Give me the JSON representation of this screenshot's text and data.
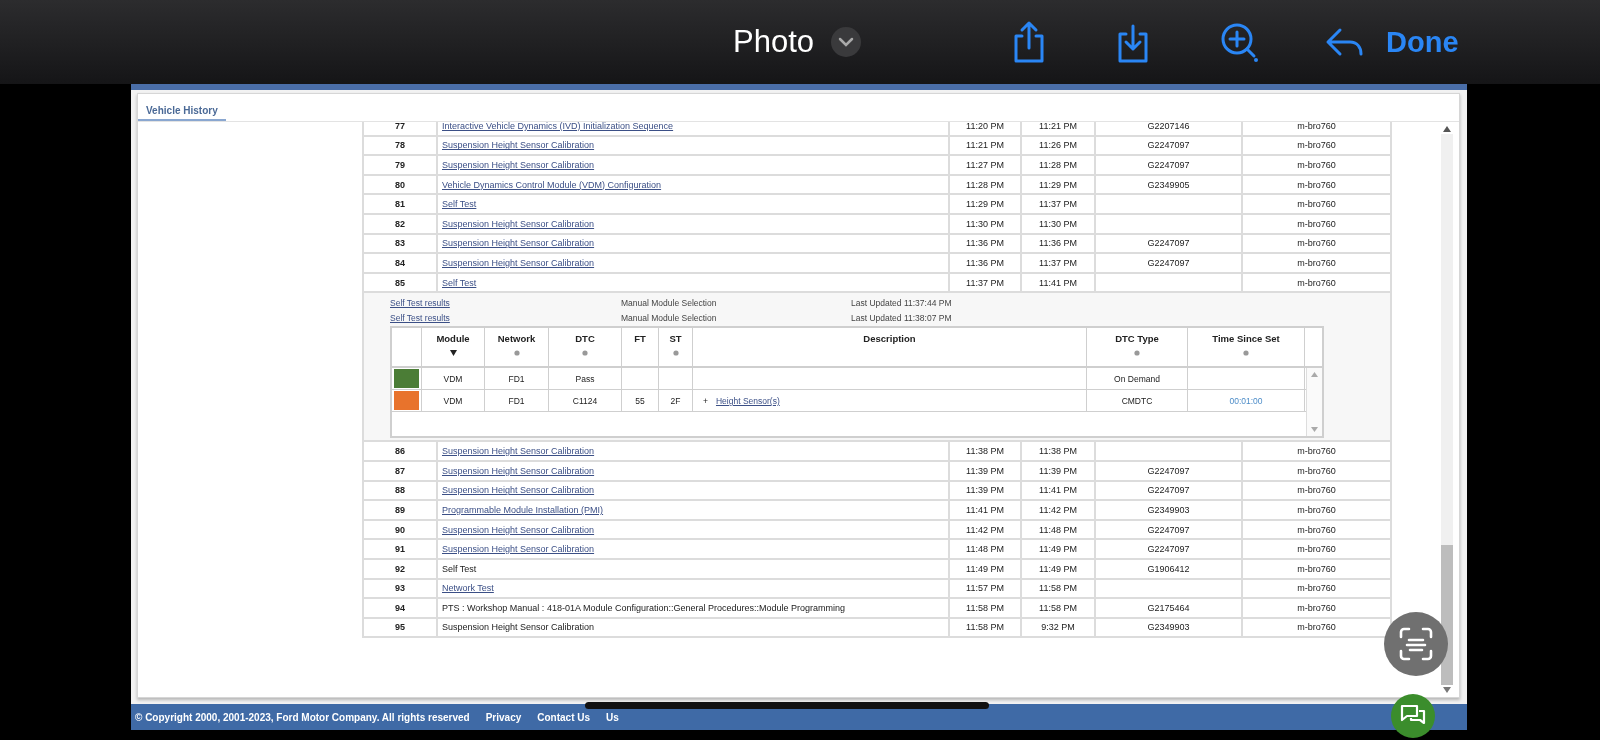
{
  "viewer": {
    "title": "Photo",
    "done": "Done"
  },
  "tab": {
    "label": "Vehicle History",
    "selected": true
  },
  "history": {
    "rows": [
      {
        "number": "77",
        "description": "Interactive Vehicle Dynamics (IVD) Initialization Sequence",
        "link": true,
        "start": "11:20 PM",
        "end": "11:21 PM",
        "code": "G2207146",
        "user": "m-bro760"
      },
      {
        "number": "78",
        "description": "Suspension Height Sensor Calibration",
        "link": true,
        "start": "11:21 PM",
        "end": "11:26 PM",
        "code": "G2247097",
        "user": "m-bro760"
      },
      {
        "number": "79",
        "description": "Suspension Height Sensor Calibration",
        "link": true,
        "start": "11:27 PM",
        "end": "11:28 PM",
        "code": "G2247097",
        "user": "m-bro760"
      },
      {
        "number": "80",
        "description": "Vehicle Dynamics Control Module (VDM) Configuration",
        "link": true,
        "start": "11:28 PM",
        "end": "11:29 PM",
        "code": "G2349905",
        "user": "m-bro760"
      },
      {
        "number": "81",
        "description": "Self Test",
        "link": true,
        "start": "11:29 PM",
        "end": "11:37 PM",
        "user": "m-bro760"
      },
      {
        "number": "82",
        "description": "Suspension Height Sensor Calibration",
        "link": true,
        "start": "11:30 PM",
        "end": "11:30 PM",
        "user": "m-bro760"
      },
      {
        "number": "83",
        "description": "Suspension Height Sensor Calibration",
        "link": true,
        "start": "11:36 PM",
        "end": "11:36 PM",
        "code": "G2247097",
        "user": "m-bro760"
      },
      {
        "number": "84",
        "description": "Suspension Height Sensor Calibration",
        "link": true,
        "start": "11:36 PM",
        "end": "11:37 PM",
        "code": "G2247097",
        "user": "m-bro760"
      },
      {
        "number": "85",
        "description": "Self Test",
        "link": true,
        "start": "11:37 PM",
        "end": "11:41 PM",
        "user": "m-bro760",
        "details": {
          "results": [
            {
              "label": "Self Test results",
              "selection": "Manual Module Selection",
              "updated": "Last Updated 11:37:44 PM"
            },
            {
              "label": "Self Test results",
              "selection": "Manual Module Selection",
              "updated": "Last Updated 11:38:07 PM"
            }
          ],
          "columns": [
            {
              "label": "Module",
              "sorted": true
            },
            {
              "label": "Network",
              "sorted": false
            },
            {
              "label": "DTC",
              "sorted": false
            },
            {
              "label": "FT"
            },
            {
              "label": "ST",
              "sorted": false
            },
            {
              "label": "Description"
            },
            {
              "label": "DTC Type",
              "sorted": false
            },
            {
              "label": "Time Since Set",
              "sorted": false
            }
          ],
          "dtc_rows": [
            {
              "color": "#4b7d36",
              "module": "VDM",
              "network": "FD1",
              "dtc": "Pass",
              "type": "On Demand"
            },
            {
              "color": "#e8732c",
              "module": "VDM",
              "network": "FD1",
              "dtc": "C1124",
              "ft": "55",
              "st": "2F",
              "expander": "+",
              "description": "Height Sensor(s)",
              "type": "CMDTC",
              "time": "00:01:00"
            }
          ]
        }
      },
      {
        "number": "86",
        "description": "Suspension Height Sensor Calibration",
        "link": true,
        "start": "11:38 PM",
        "end": "11:38 PM",
        "user": "m-bro760"
      },
      {
        "number": "87",
        "description": "Suspension Height Sensor Calibration",
        "link": true,
        "start": "11:39 PM",
        "end": "11:39 PM",
        "code": "G2247097",
        "user": "m-bro760"
      },
      {
        "number": "88",
        "description": "Suspension Height Sensor Calibration",
        "link": true,
        "start": "11:39 PM",
        "end": "11:41 PM",
        "code": "G2247097",
        "user": "m-bro760"
      },
      {
        "number": "89",
        "description": "Programmable Module Installation (PMI)",
        "link": true,
        "start": "11:41 PM",
        "end": "11:42 PM",
        "code": "G2349903",
        "user": "m-bro760"
      },
      {
        "number": "90",
        "description": "Suspension Height Sensor Calibration",
        "link": true,
        "start": "11:42 PM",
        "end": "11:48 PM",
        "code": "G2247097",
        "user": "m-bro760"
      },
      {
        "number": "91",
        "description": "Suspension Height Sensor Calibration",
        "link": true,
        "start": "11:48 PM",
        "end": "11:49 PM",
        "code": "G2247097",
        "user": "m-bro760"
      },
      {
        "number": "92",
        "description": "Self Test",
        "link": false,
        "start": "11:49 PM",
        "end": "11:49 PM",
        "code": "G1906412",
        "user": "m-bro760"
      },
      {
        "number": "93",
        "description": "Network Test",
        "link": true,
        "start": "11:57 PM",
        "end": "11:58 PM",
        "user": "m-bro760"
      },
      {
        "number": "94",
        "description": "PTS : Workshop Manual : 418-01A Module Configuration::General Procedures::Module Programming",
        "link": false,
        "start": "11:58 PM",
        "end": "11:58 PM",
        "code": "G2175464",
        "user": "m-bro760"
      },
      {
        "number": "95",
        "description": "Suspension Height Sensor Calibration",
        "link": false,
        "start": "11:58 PM",
        "end": "9:32 PM",
        "code": "G2349903",
        "user": "m-bro760"
      }
    ]
  },
  "footer": {
    "copyright": "© Copyright 2000, 2001-2023, Ford Motor Company. All rights reserved",
    "links": [
      "Privacy",
      "Contact Us",
      "Us"
    ]
  }
}
